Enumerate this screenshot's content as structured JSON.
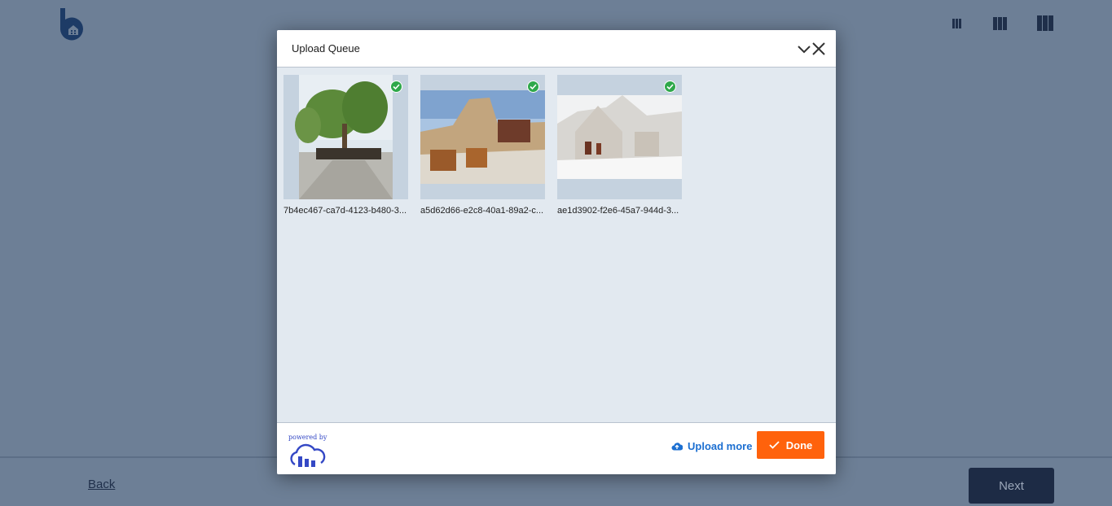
{
  "app": {
    "logo_icon": "brand-b-logo-icon",
    "view_icons": [
      "view-small-icon",
      "view-medium-icon",
      "view-large-icon"
    ],
    "footer": {
      "back_label": "Back",
      "next_label": "Next"
    }
  },
  "modal": {
    "title": "Upload Queue",
    "collapse_icon": "chevron-down-icon",
    "close_icon": "close-icon",
    "files": [
      {
        "name": "7b4ec467-ca7d-4123-b480-3...",
        "status": "uploaded"
      },
      {
        "name": "a5d62d66-e2c8-40a1-89a2-c...",
        "status": "uploaded"
      },
      {
        "name": "ae1d3902-f2e6-45a7-944d-3...",
        "status": "uploaded"
      }
    ],
    "footer": {
      "powered_by": "powered by",
      "upload_more_label": "Upload more",
      "done_label": "Done"
    }
  },
  "colors": {
    "backdrop": "#6d7f96",
    "accent_orange": "#ff620c",
    "link_blue": "#1c6fd1",
    "success_green": "#2fa84a"
  }
}
